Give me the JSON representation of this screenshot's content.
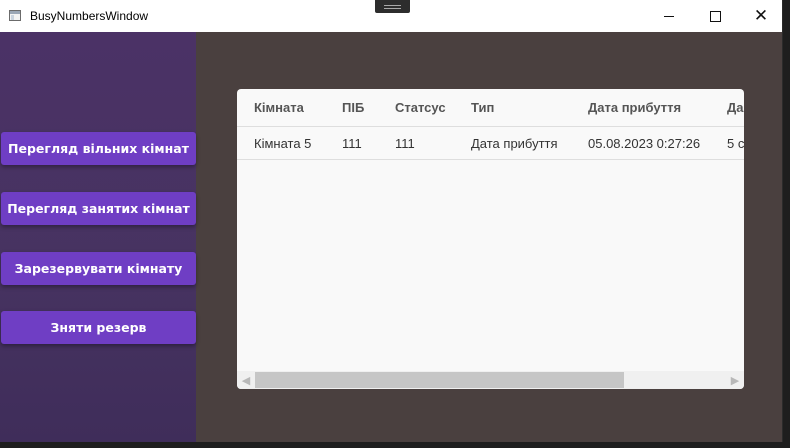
{
  "window": {
    "title": "BusyNumbersWindow",
    "controls": {
      "minimize": "minimize-icon",
      "maximize": "maximize-icon",
      "close": "close-icon"
    }
  },
  "sidebar": {
    "buttons": [
      "Перегляд вільних кімнат",
      "Перегляд занятих кімнат",
      "Зарезервувати кімнату",
      "Зняти резерв"
    ]
  },
  "grid": {
    "columns": [
      "Кімната",
      "ПІБ",
      "Статсус",
      "Тип",
      "Дата прибуття",
      "Да"
    ],
    "rows": [
      [
        "Кімната 5",
        "111",
        "111",
        "Дата прибуття",
        "05.08.2023 0:27:26",
        "5 с"
      ]
    ],
    "scroll_fraction": 0
  },
  "colors": {
    "button": "#6f3ec4",
    "sidebar": "#4b3266",
    "content_bg": "#4a403f",
    "grid_bg": "#f9f9f9"
  }
}
